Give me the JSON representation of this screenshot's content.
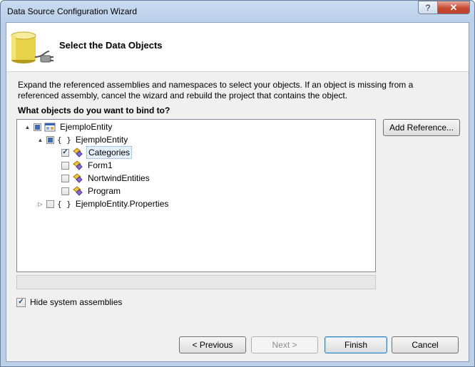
{
  "window": {
    "title": "Data Source Configuration Wizard",
    "help_glyph": "?",
    "close_glyph": "✕"
  },
  "header": {
    "title": "Select the Data Objects"
  },
  "description": "Expand the referenced assemblies and namespaces to select your objects. If an object is missing from a referenced assembly, cancel the wizard and rebuild the project that contains the object.",
  "question": "What objects do you want to bind to?",
  "tree": {
    "nodes": [
      {
        "label": "EjemploEntity",
        "check": "partial",
        "expander": "▲",
        "icon": "assembly-icon"
      },
      {
        "label": "EjemploEntity",
        "check": "partial",
        "expander": "▲",
        "icon": "namespace-icon",
        "icon_text": "{ }"
      },
      {
        "label": "Categories",
        "check": "checked",
        "icon": "class-icon",
        "selected": true
      },
      {
        "label": "Form1",
        "check": "unchecked",
        "icon": "class-icon"
      },
      {
        "label": "NortwindEntities",
        "check": "unchecked",
        "icon": "class-icon"
      },
      {
        "label": "Program",
        "check": "unchecked",
        "icon": "class-icon"
      },
      {
        "label": "EjemploEntity.Properties",
        "check": "unchecked",
        "expander": "▷",
        "icon": "namespace-icon",
        "icon_text": "{ }"
      }
    ]
  },
  "buttons": {
    "add_reference": "Add Reference...",
    "previous": "< Previous",
    "next": "Next >",
    "finish": "Finish",
    "cancel": "Cancel"
  },
  "hide_system": {
    "label": "Hide system assemblies",
    "checked": true
  },
  "colors": {
    "title_bar": "#bcd0ea",
    "close_button": "#c74a31",
    "selection": "#e5f0fb",
    "partial_check": "#3e6bb8"
  }
}
